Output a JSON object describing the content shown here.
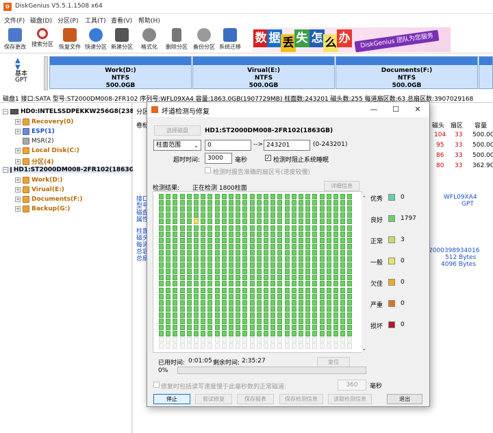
{
  "app": {
    "title": "DiskGenius V5.5.1.1508 x64",
    "icon_text": "D"
  },
  "menu": [
    "文件(F)",
    "磁盘(D)",
    "分区(P)",
    "工具(T)",
    "查看(V)",
    "帮助(H)"
  ],
  "toolbar": [
    "保存更改",
    "搜索分区",
    "恢复文件",
    "快速分区",
    "新建分区",
    "格式化",
    "删除分区",
    "备份分区",
    "系统迁移"
  ],
  "banner": {
    "chars": [
      "数",
      "据",
      "丢",
      "失",
      "怎",
      "么",
      "办"
    ],
    "slogan": "DiskGenius 团队为您服务"
  },
  "disk_left": {
    "line1": "基本",
    "line2": "GPT"
  },
  "partitions": [
    {
      "name": "Work(D:)",
      "fs": "NTFS",
      "size": "500.0GB"
    },
    {
      "name": "Virual(E:)",
      "fs": "NTFS",
      "size": "500.0GB"
    },
    {
      "name": "Documents(F:)",
      "fs": "NTFS",
      "size": "500.0GB"
    }
  ],
  "disk_info": "磁盘1 接口:SATA  型号:ST2000DM008-2FR102  序列号:WFL09XA4  容量:1863.0GB(1907729MB)  柱面数:243201  磁头数:255  每道扇区数:63  总扇区数:3907029168",
  "tree": [
    {
      "label": "HD0:INTELSSDPEKKW256G8(238GB)",
      "style": "bold"
    },
    {
      "label": "Recovery(0)",
      "style": "orange"
    },
    {
      "label": "ESP(1)",
      "style": "blue"
    },
    {
      "label": "MSR(2)",
      "style": "dark"
    },
    {
      "label": "Local Disk(C:)",
      "style": "orange"
    },
    {
      "label": "分区(4)",
      "style": "orange"
    },
    {
      "label": "HD1:ST2000DM008-2FR102(1863GB)",
      "style": "bold"
    },
    {
      "label": "Work(D:)",
      "style": "orange"
    },
    {
      "label": "Virual(E:)",
      "style": "orange"
    },
    {
      "label": "Documents(F:)",
      "style": "orange"
    },
    {
      "label": "Backup(G:)",
      "style": "orange"
    }
  ],
  "rightpane": {
    "tab": "分区",
    "hdr": "卷标",
    "cols": [
      "磁头",
      "扇区",
      "容量"
    ],
    "rows": [
      [
        "104",
        "33",
        "500.0G"
      ],
      [
        "95",
        "33",
        "500.0G"
      ],
      [
        "86",
        "33",
        "500.0G"
      ],
      [
        "80",
        "33",
        "362.9G"
      ]
    ],
    "side_labels": [
      "接口",
      "型号",
      "磁盘",
      "属性",
      "柱面",
      "磁头",
      "每道",
      "总容",
      "总扇"
    ],
    "serial": "WFL09XA4",
    "gpt": "GPT",
    "total": "2000398934016",
    "bytes1": "512 Bytes",
    "bytes2": "4096 Bytes"
  },
  "dialog": {
    "title": "坏道检测与修复",
    "select_disk": "选择磁盘",
    "disk_name": "HD1:ST2000DM008-2FR102(1863GB)",
    "range_type": "柱面范围",
    "from": "0",
    "arrow": "-->",
    "to": "243201",
    "range_hint": "(0-243201)",
    "timeout_label": "超时时间:",
    "timeout": "3000",
    "ms": "毫秒",
    "prevent_sleep": "检测时阻止系统睡眠",
    "report_sector": "检测时报告准确的扇区号(速度较慢)",
    "result_label": "检测结果:",
    "result_status": "正在检测 1800柱面",
    "detail_btn": "详细信息",
    "legend": [
      {
        "label": "优秀",
        "count": "0",
        "color": "#5fd3a8"
      },
      {
        "label": "良好",
        "count": "1797",
        "color": "#6fce67"
      },
      {
        "label": "正常",
        "count": "3",
        "color": "#c7dc6a"
      },
      {
        "label": "一般",
        "count": "0",
        "color": "#ede26a"
      },
      {
        "label": "欠佳",
        "count": "0",
        "color": "#e8ac2c"
      },
      {
        "label": "严重",
        "count": "0",
        "color": "#d9771c"
      },
      {
        "label": "损坏",
        "count": "0",
        "color": "#b3172a"
      }
    ],
    "elapsed_label": "已用时间:",
    "elapsed": "0:01:05",
    "remain_label": "剩余时间:",
    "remain": "2:35:27",
    "reset_btn": "复位",
    "percent": "0%",
    "progress": 0.0,
    "repair_option": "修复时包括读写速度慢于此毫秒数的正常磁道:",
    "slow_ms": "360",
    "slow_unit": "毫秒",
    "buttons": [
      "停止",
      "尝试修复",
      "保存报表",
      "保存检测信息",
      "读取检测信息",
      "退出"
    ]
  }
}
